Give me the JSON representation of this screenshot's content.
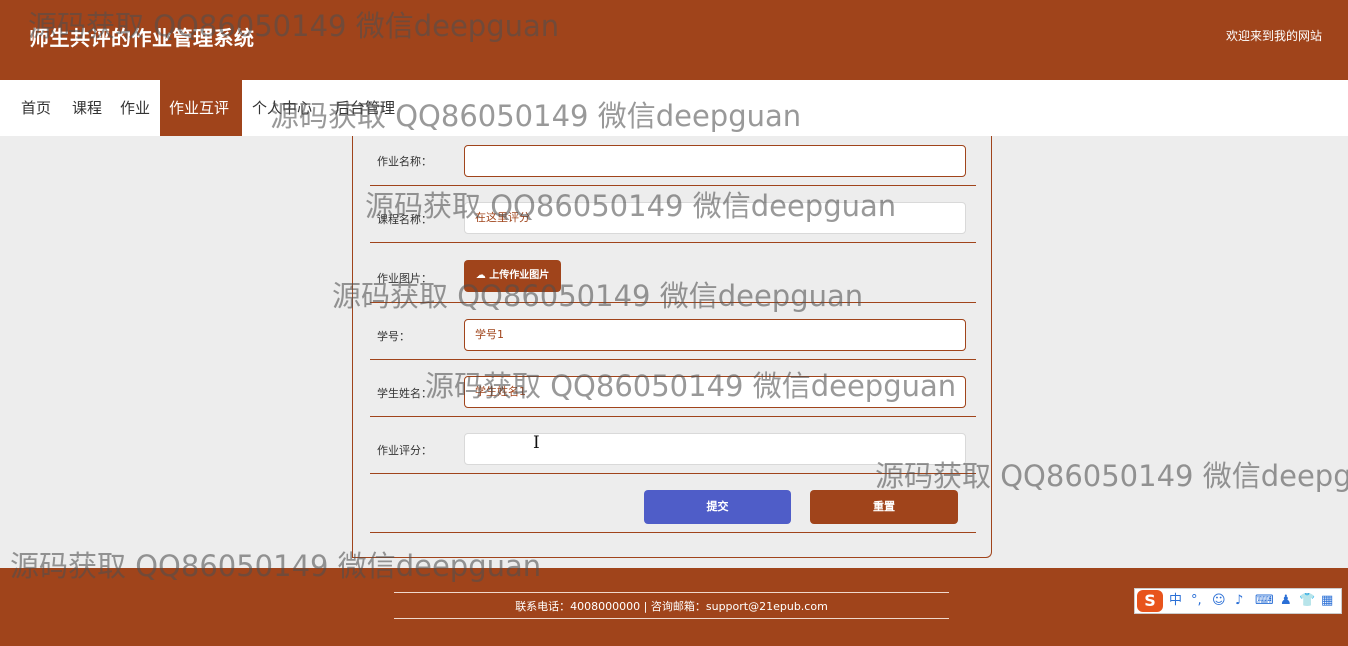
{
  "header": {
    "title": "师生共评的作业管理系统",
    "welcome": "欢迎来到我的网站"
  },
  "nav": {
    "items": [
      "首页",
      "课程",
      "作业",
      "作业互评",
      "个人中心",
      "后台管理"
    ]
  },
  "form": {
    "fields": [
      {
        "label": "作业名称：",
        "value": ""
      },
      {
        "label": "课程名称：",
        "value": "在这里评分"
      },
      {
        "label": "作业图片：",
        "button": "上传作业图片"
      },
      {
        "label": "学号：",
        "value": "学号1"
      },
      {
        "label": "学生姓名：",
        "value": "学生姓名1"
      },
      {
        "label": "作业评分：",
        "value": ""
      }
    ],
    "submit": "提交",
    "reset": "重置"
  },
  "footer": {
    "text": "联系电话：4008000000 | 咨询邮箱：support@21epub.com"
  },
  "ime": {
    "logo": "S",
    "icons": [
      "中",
      "°,",
      "☺",
      "♪",
      "⌨",
      "♟",
      "👕",
      "▦"
    ]
  },
  "watermark": "源码获取 QQ86050149 微信deepguan",
  "colors": {
    "brand": "#a0441b",
    "submit": "#4f5dc8",
    "background": "#ededed"
  }
}
